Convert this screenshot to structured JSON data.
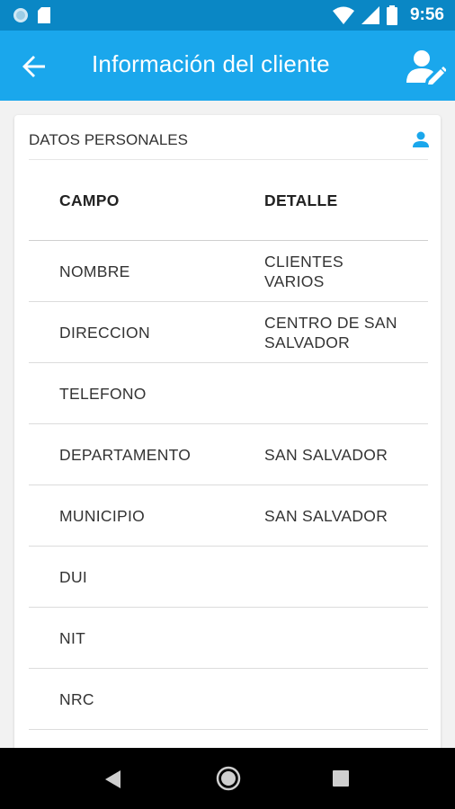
{
  "status_bar": {
    "time": "9:56",
    "icons": [
      "circle-notification-icon",
      "sd-card-icon",
      "wifi-icon",
      "signal-icon",
      "battery-icon"
    ]
  },
  "app_bar": {
    "title": "Información del cliente",
    "back_icon": "arrow-back-icon",
    "action_icon": "edit-user-icon"
  },
  "card": {
    "section_title": "DATOS PERSONALES",
    "section_icon": "person-icon",
    "table": {
      "headers": {
        "field": "CAMPO",
        "detail": "DETALLE"
      },
      "rows": [
        {
          "field": "NOMBRE",
          "detail": "CLIENTES VARIOS"
        },
        {
          "field": "DIRECCION",
          "detail": "CENTRO DE SAN SALVADOR"
        },
        {
          "field": "TELEFONO",
          "detail": ""
        },
        {
          "field": "DEPARTAMENTO",
          "detail": "SAN SALVADOR"
        },
        {
          "field": "MUNICIPIO",
          "detail": "SAN SALVADOR"
        },
        {
          "field": "DUI",
          "detail": ""
        },
        {
          "field": "NIT",
          "detail": ""
        },
        {
          "field": "NRC",
          "detail": ""
        }
      ]
    }
  },
  "nav_bar": {
    "icons": [
      "back-triangle-icon",
      "home-circle-icon",
      "recents-square-icon"
    ]
  },
  "colors": {
    "status_bar": "#0a87c5",
    "app_bar": "#1aa7ec",
    "accent": "#1aa7ec"
  }
}
